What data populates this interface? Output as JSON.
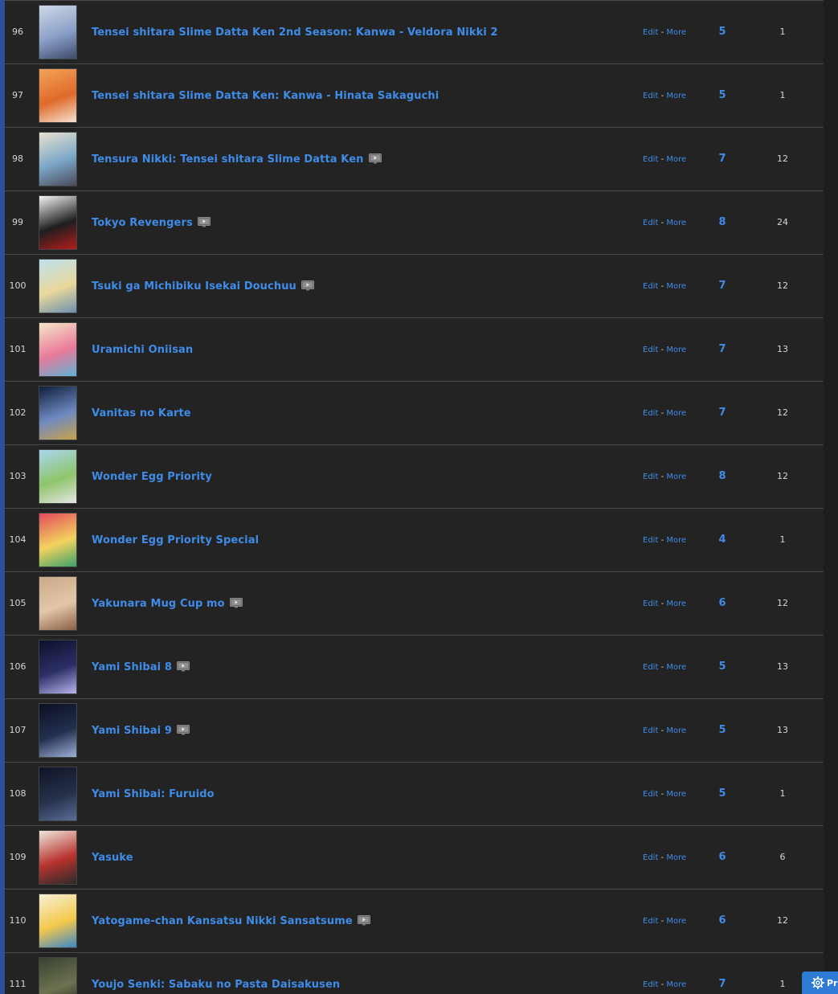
{
  "actions": {
    "edit": "Edit",
    "sep": "-",
    "more": "More"
  },
  "rows": [
    {
      "num": "96",
      "title": "Tensei shitara Slime Datta Ken 2nd Season: Kanwa - Veldora Nikki 2",
      "stream": false,
      "score": "5",
      "eps": "1",
      "cover": [
        "#cfd8e6",
        "#8aa0c8",
        "#3d4a6a"
      ]
    },
    {
      "num": "97",
      "title": "Tensei shitara Slime Datta Ken: Kanwa - Hinata Sakaguchi",
      "stream": false,
      "score": "5",
      "eps": "1",
      "cover": [
        "#f2a35a",
        "#e06a2a",
        "#f5e2cf"
      ]
    },
    {
      "num": "98",
      "title": "Tensura Nikki: Tensei shitara Slime Datta Ken",
      "stream": true,
      "score": "7",
      "eps": "12",
      "cover": [
        "#e9e1cf",
        "#7aa7c8",
        "#4a4a58"
      ]
    },
    {
      "num": "99",
      "title": "Tokyo Revengers",
      "stream": true,
      "score": "8",
      "eps": "24",
      "cover": [
        "#f4f4f4",
        "#1e1e1e",
        "#b51c1c"
      ]
    },
    {
      "num": "100",
      "title": "Tsuki ga Michibiku Isekai Douchuu",
      "stream": true,
      "score": "7",
      "eps": "12",
      "cover": [
        "#bfe1f0",
        "#e8d89a",
        "#6c8fb0"
      ]
    },
    {
      "num": "101",
      "title": "Uramichi Oniisan",
      "stream": false,
      "score": "7",
      "eps": "13",
      "cover": [
        "#f7e6c6",
        "#e87a9a",
        "#5fb2d6"
      ]
    },
    {
      "num": "102",
      "title": "Vanitas no Karte",
      "stream": false,
      "score": "7",
      "eps": "12",
      "cover": [
        "#0f1f3a",
        "#6e89c2",
        "#c9a24a"
      ]
    },
    {
      "num": "103",
      "title": "Wonder Egg Priority",
      "stream": false,
      "score": "8",
      "eps": "12",
      "cover": [
        "#a9d6ee",
        "#8fc56b",
        "#e6e6e6"
      ]
    },
    {
      "num": "104",
      "title": "Wonder Egg Priority Special",
      "stream": false,
      "score": "4",
      "eps": "1",
      "cover": [
        "#e14a5c",
        "#f4d35e",
        "#3aa16a"
      ]
    },
    {
      "num": "105",
      "title": "Yakunara Mug Cup mo",
      "stream": true,
      "score": "6",
      "eps": "12",
      "cover": [
        "#c9a98a",
        "#e3c7a8",
        "#8a5f45"
      ]
    },
    {
      "num": "106",
      "title": "Yami Shibai 8",
      "stream": true,
      "score": "5",
      "eps": "13",
      "cover": [
        "#0d0f2a",
        "#2c2f66",
        "#b8b4ee"
      ]
    },
    {
      "num": "107",
      "title": "Yami Shibai 9",
      "stream": true,
      "score": "5",
      "eps": "13",
      "cover": [
        "#0c0f22",
        "#22304f",
        "#9fb0d6"
      ]
    },
    {
      "num": "108",
      "title": "Yami Shibai: Furuido",
      "stream": false,
      "score": "5",
      "eps": "1",
      "cover": [
        "#0f1426",
        "#25304a",
        "#5a6d96"
      ]
    },
    {
      "num": "109",
      "title": "Yasuke",
      "stream": false,
      "score": "6",
      "eps": "6",
      "cover": [
        "#efe6dd",
        "#b8332e",
        "#2a2a2a"
      ]
    },
    {
      "num": "110",
      "title": "Yatogame-chan Kansatsu Nikki Sansatsume",
      "stream": true,
      "score": "6",
      "eps": "12",
      "cover": [
        "#f6f0d8",
        "#f4c84a",
        "#3a86c8"
      ]
    },
    {
      "num": "111",
      "title": "Youjo Senki: Sabaku no Pasta Daisakusen",
      "stream": false,
      "score": "7",
      "eps": "1",
      "cover": [
        "#3a4030",
        "#6b7350",
        "#1f2418"
      ]
    }
  ],
  "preferences_button": {
    "label": "Preferences",
    "icon": "gear-icon"
  }
}
